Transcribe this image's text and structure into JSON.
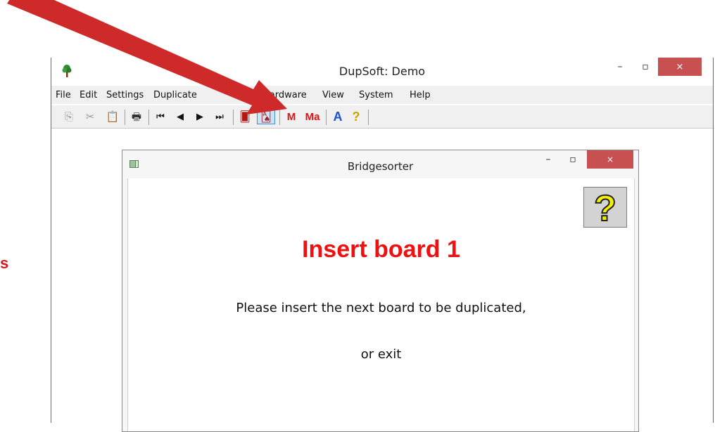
{
  "stray_label": "s",
  "main_window": {
    "title": "DupSoft: Demo",
    "minimize_glyph": "–",
    "maximize_glyph": "▫",
    "close_glyph": "×",
    "menu": [
      "File",
      "Edit",
      "Settings",
      "Duplicate",
      "Hardware",
      "View",
      "System",
      "Help"
    ],
    "toolbar": {
      "buttons": [
        {
          "icon": "copy-icon",
          "glyph": "⎘"
        },
        {
          "icon": "cut-icon",
          "glyph": "✂"
        },
        {
          "icon": "paste-icon",
          "glyph": "📋"
        },
        {
          "icon": "print-icon",
          "glyph": "🖶"
        },
        {
          "icon": "first-icon",
          "glyph": "⏮"
        },
        {
          "icon": "previous-icon",
          "glyph": "◀"
        },
        {
          "icon": "next-icon",
          "glyph": "▶"
        },
        {
          "icon": "last-icon",
          "glyph": "⏭"
        },
        {
          "icon": "board-icon",
          "glyph": "🂠"
        },
        {
          "icon": "bridgesorter-icon",
          "glyph": "🂡",
          "active": true
        },
        {
          "text": "M",
          "color": "#e01414"
        },
        {
          "text": "Ma",
          "color": "#e01414"
        },
        {
          "text": "A",
          "color": "#1a4fd8"
        },
        {
          "icon": "help-icon",
          "glyph": "?"
        }
      ]
    }
  },
  "dialog": {
    "title": "Bridgesorter",
    "minimize_glyph": "–",
    "maximize_glyph": "▫",
    "close_glyph": "×",
    "heading": "Insert board 1",
    "message": "Please insert the next board to be duplicated,",
    "message2": "or exit",
    "help_glyph": "?"
  },
  "colors": {
    "accent_red": "#ee1111",
    "arrow_red": "#cf2a2a",
    "close_red": "#c75050",
    "active_tool": "#cce4f7"
  }
}
